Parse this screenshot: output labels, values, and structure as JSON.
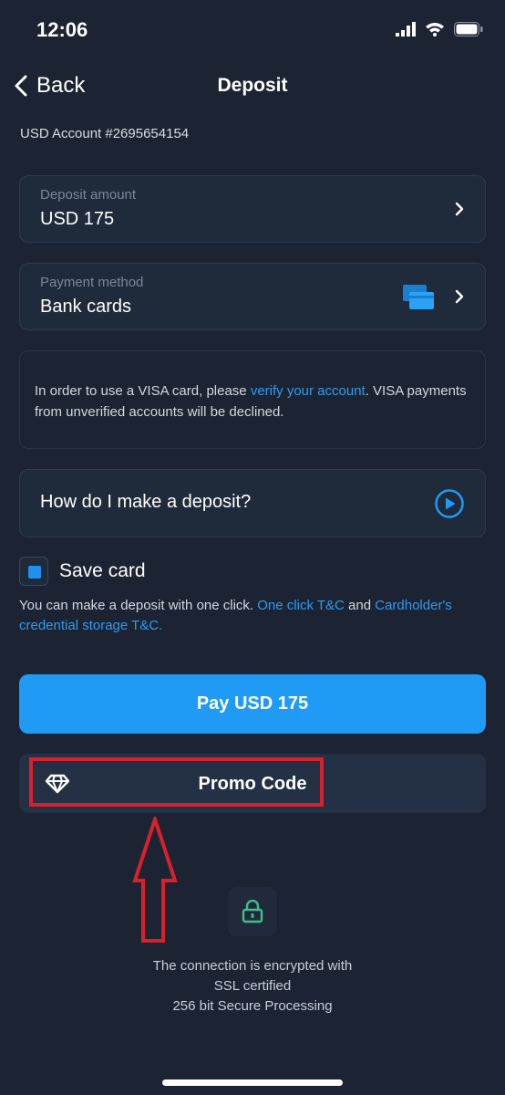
{
  "status_bar": {
    "time": "12:06"
  },
  "nav": {
    "back_label": "Back",
    "title": "Deposit"
  },
  "account": {
    "label": "USD Account #2695654154"
  },
  "deposit_amount": {
    "label": "Deposit amount",
    "value": "USD 175"
  },
  "payment_method": {
    "label": "Payment method",
    "value": "Bank cards",
    "icon": "bank-cards-icon"
  },
  "notice": {
    "text_before": "In order to use a VISA card, please ",
    "link": "verify your account",
    "text_after": ". VISA payments from unverified accounts will be declined."
  },
  "howto": {
    "label": "How do I make a deposit?",
    "icon": "play-icon"
  },
  "save_card": {
    "label": "Save card",
    "checked": true
  },
  "one_click": {
    "text_before": "You can make a deposit with one click. ",
    "link1": "One click T&C",
    "middle": " and ",
    "link2": "Cardholder's credential storage T&C."
  },
  "pay_button": {
    "label": "Pay USD 175"
  },
  "promo": {
    "label": "Promo Code",
    "icon": "diamond-icon"
  },
  "security": {
    "line1": "The connection is encrypted with",
    "line2": "SSL certified",
    "line3": "256 bit Secure Processing",
    "icon": "lock-icon"
  },
  "colors": {
    "background": "#1c2433",
    "accent": "#1f9bf5",
    "link": "#2e9bf0",
    "highlight": "#d8212a",
    "lock": "#3fbf8a"
  }
}
